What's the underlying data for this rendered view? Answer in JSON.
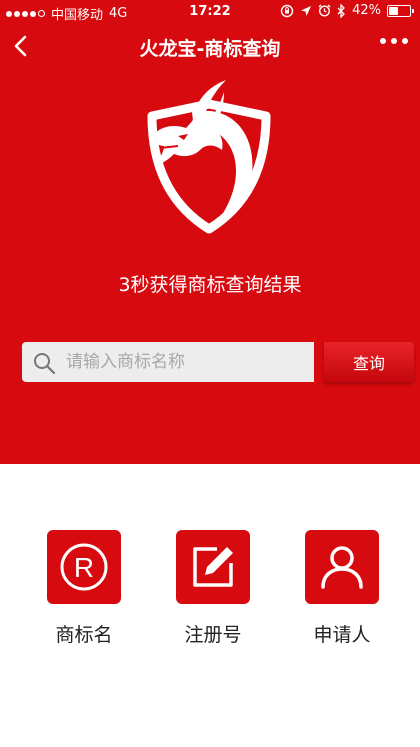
{
  "status_bar": {
    "carrier": "中国移动",
    "network": "4G",
    "time": "17:22",
    "battery_text": "42%",
    "battery_level": 0.42
  },
  "nav": {
    "title": "火龙宝-商标查询"
  },
  "hero": {
    "tagline": "3秒获得商标查询结果"
  },
  "search": {
    "placeholder": "请输入商标名称",
    "value": "",
    "button_label": "查询"
  },
  "categories": [
    {
      "label": "商标名",
      "icon": "registered-icon"
    },
    {
      "label": "注册号",
      "icon": "edit-icon"
    },
    {
      "label": "申请人",
      "icon": "person-icon"
    }
  ],
  "colors": {
    "brand_red": "#d60a0f",
    "search_bg": "#ededed"
  }
}
